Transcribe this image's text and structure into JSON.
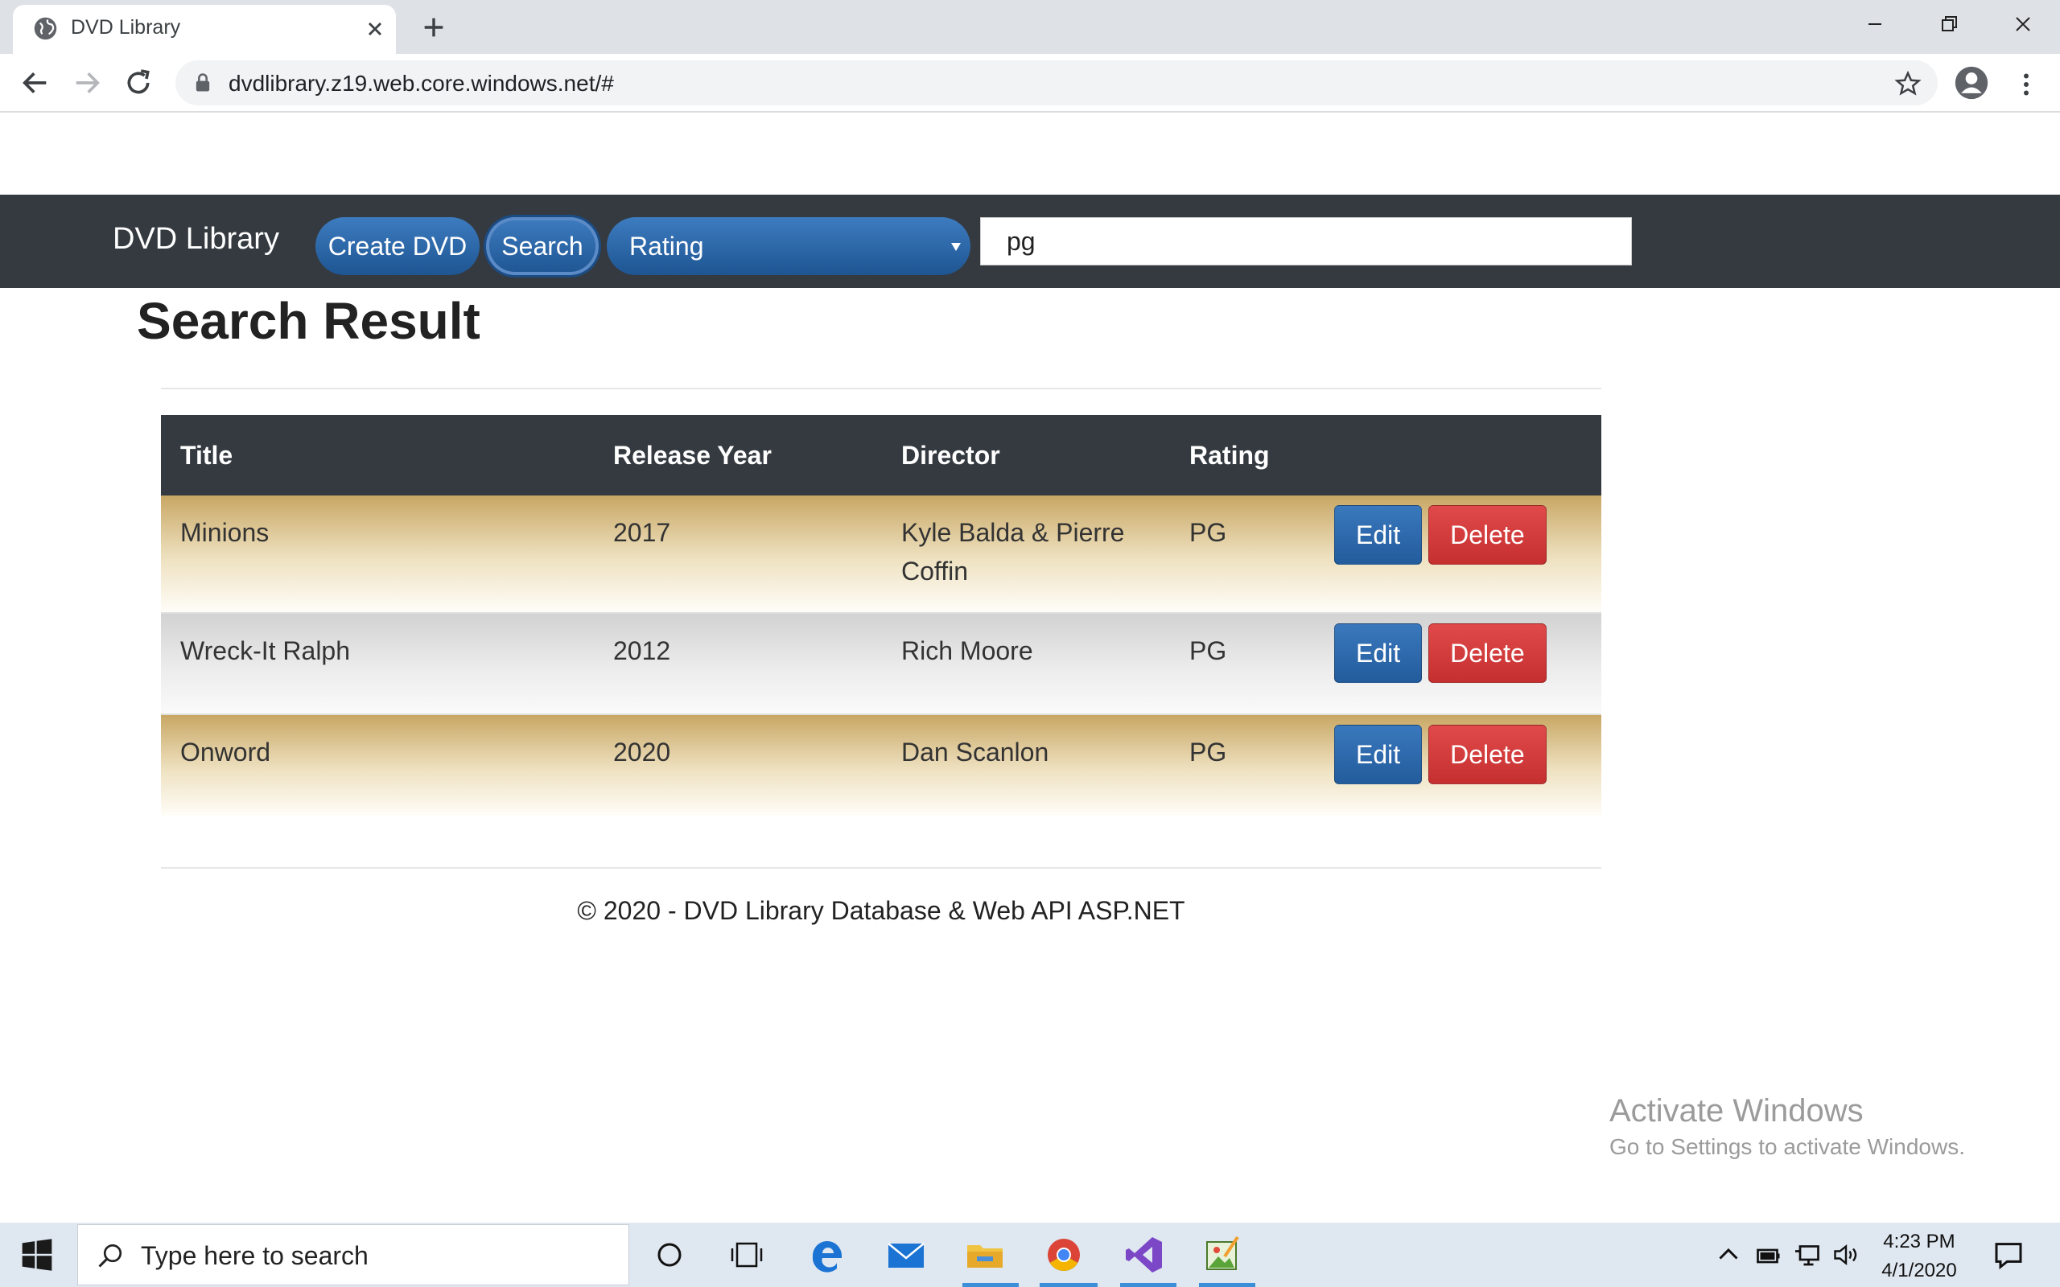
{
  "browser": {
    "tab_title": "DVD Library",
    "url": "dvdlibrary.z19.web.core.windows.net/#"
  },
  "navbar": {
    "brand": "DVD Library",
    "create_label": "Create DVD",
    "search_label": "Search",
    "category_selected": "Rating",
    "search_value": "pg"
  },
  "main": {
    "heading": "Search Result",
    "table": {
      "headers": [
        "Title",
        "Release Year",
        "Director",
        "Rating"
      ],
      "rows": [
        {
          "title": "Minions",
          "year": "2017",
          "director": "Kyle Balda & Pierre Coffin",
          "rating": "PG"
        },
        {
          "title": "Wreck-It Ralph",
          "year": "2012",
          "director": "Rich Moore",
          "rating": "PG"
        },
        {
          "title": "Onword",
          "year": "2020",
          "director": "Dan Scanlon",
          "rating": "PG"
        }
      ],
      "edit_label": "Edit",
      "delete_label": "Delete"
    }
  },
  "footer": {
    "text": "© 2020 - DVD Library Database & Web API ASP.NET"
  },
  "watermark": {
    "title": "Activate Windows",
    "subtitle": "Go to Settings to activate Windows."
  },
  "taskbar": {
    "search_placeholder": "Type here to search",
    "time": "4:23 PM",
    "date": "4/1/2020"
  },
  "colors": {
    "navbar_bg": "#343a40",
    "primary": "#2a6aaf",
    "danger": "#d9393a",
    "row_gold": "#c8a764",
    "row_gray": "#d2d2d2"
  }
}
